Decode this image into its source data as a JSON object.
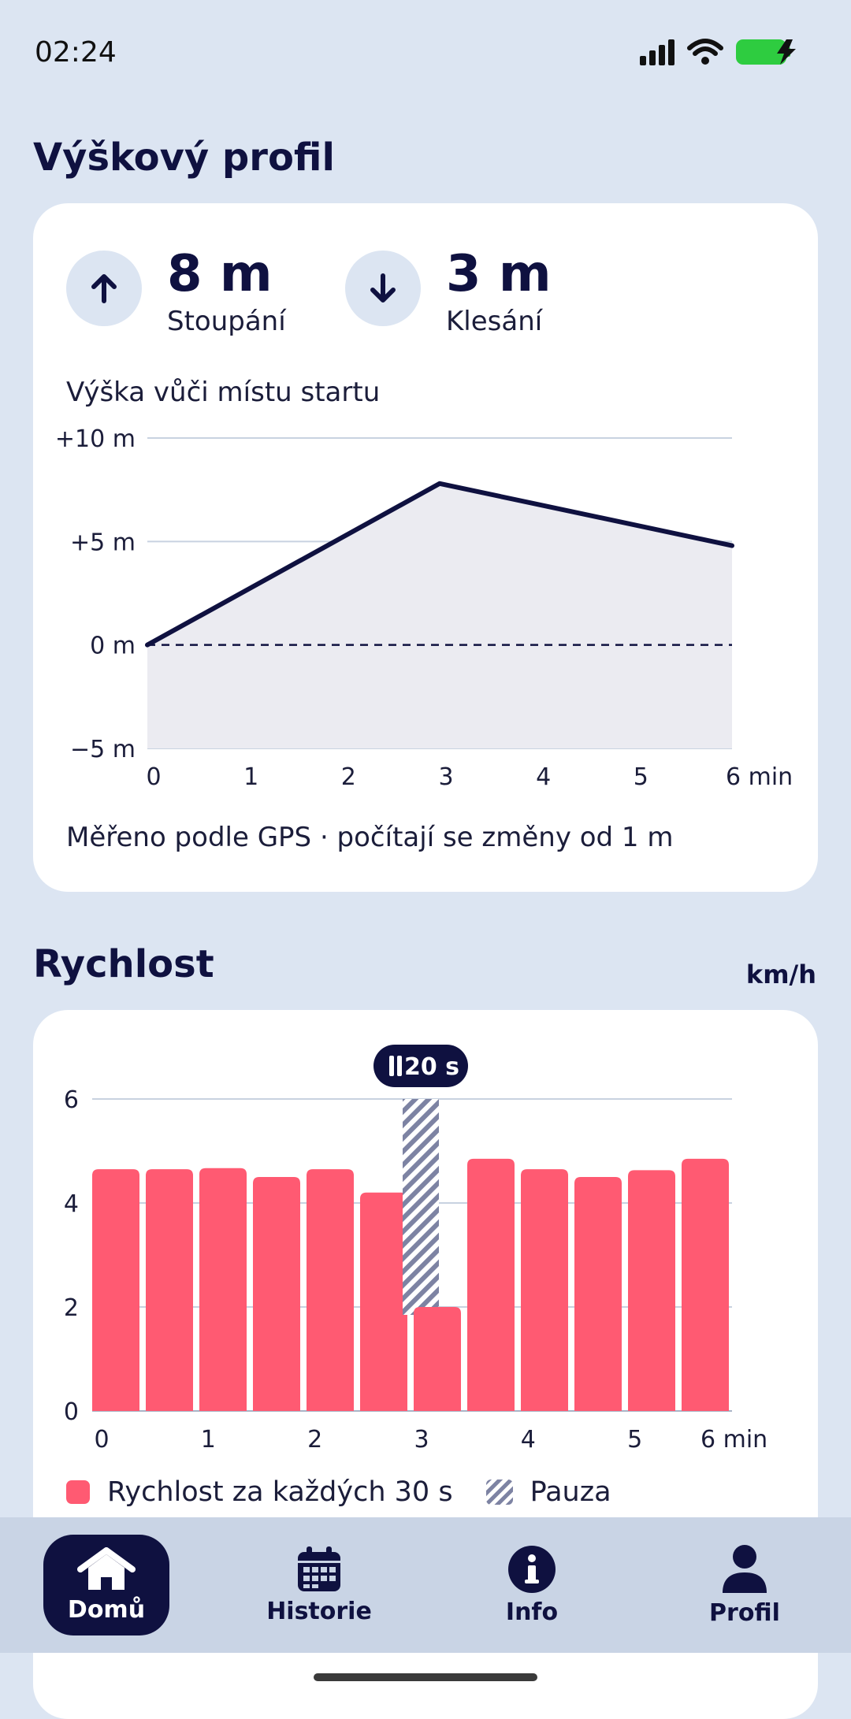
{
  "status_bar": {
    "time": "02:24"
  },
  "elevation": {
    "title": "Výškový profil",
    "ascent": {
      "value": "8 m",
      "label": "Stoupání",
      "icon": "arrow-up-icon"
    },
    "descent": {
      "value": "3 m",
      "label": "Klesání",
      "icon": "arrow-down-icon"
    },
    "chart_caption": "Výška vůči místu startu",
    "footnote": "Měřeno podle GPS · počítají se změny od 1 m"
  },
  "speed": {
    "title": "Rychlost",
    "unit": "km/h",
    "pause_badge": "20 s",
    "legend": {
      "speed": "Rychlost za každých 30 s",
      "pause": "Pauza"
    }
  },
  "nav": {
    "items": [
      {
        "label": "Domů",
        "icon": "home-icon",
        "active": true
      },
      {
        "label": "Historie",
        "icon": "calendar-icon",
        "active": false
      },
      {
        "label": "Info",
        "icon": "info-icon",
        "active": false
      },
      {
        "label": "Profil",
        "icon": "user-icon",
        "active": false
      }
    ]
  },
  "colors": {
    "accent": "#0f1140",
    "bar": "#ff5a72",
    "background": "#dce5f2"
  },
  "chart_data": [
    {
      "type": "area",
      "x": [
        0,
        3,
        6
      ],
      "y": [
        0,
        7.8,
        4.8
      ],
      "xlabel": "",
      "ylabel": "",
      "xlim": [
        0,
        6
      ],
      "ylim": [
        -5,
        10
      ],
      "x_ticks": [
        "0",
        "1",
        "2",
        "3",
        "4",
        "5",
        "6 min"
      ],
      "y_ticks": [
        "+10 m",
        "+5 m",
        "0 m",
        "−5 m"
      ],
      "grid": true,
      "reference_line": 0
    },
    {
      "type": "bar",
      "categories": [
        "0",
        "0.5",
        "1",
        "1.5",
        "2",
        "2.5",
        "3",
        "3.5",
        "4",
        "4.5",
        "5",
        "5.5"
      ],
      "values": [
        4.65,
        4.65,
        4.67,
        4.5,
        4.65,
        4.2,
        2.0,
        4.85,
        4.65,
        4.5,
        4.63,
        4.85
      ],
      "pause": {
        "at_category": 6,
        "duration": "20 s"
      },
      "xlim": [
        0,
        6
      ],
      "ylim": [
        0,
        6
      ],
      "x_ticks": [
        "0",
        "1",
        "2",
        "3",
        "4",
        "5",
        "6 min"
      ],
      "y_ticks": [
        "0",
        "2",
        "4",
        "6"
      ],
      "grid": true,
      "legend": "bottom"
    }
  ]
}
